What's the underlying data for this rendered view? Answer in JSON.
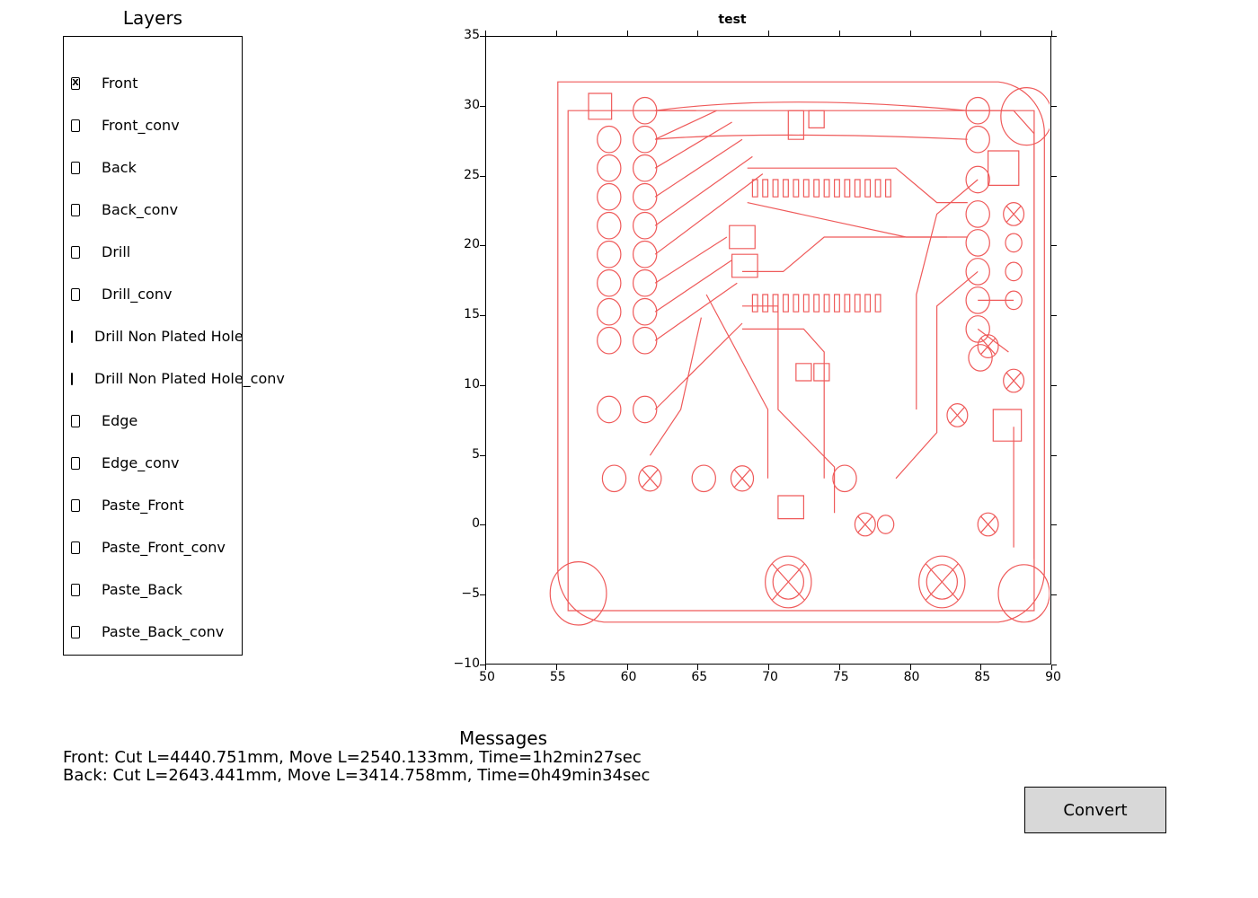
{
  "layers_panel": {
    "title": "Layers",
    "items": [
      {
        "label": "Front",
        "checked": true
      },
      {
        "label": "Front_conv",
        "checked": false
      },
      {
        "label": "Back",
        "checked": false
      },
      {
        "label": "Back_conv",
        "checked": false
      },
      {
        "label": "Drill",
        "checked": false
      },
      {
        "label": "Drill_conv",
        "checked": false
      },
      {
        "label": "Drill Non Plated Hole",
        "checked": false
      },
      {
        "label": "Drill Non Plated Hole_conv",
        "checked": false
      },
      {
        "label": "Edge",
        "checked": false
      },
      {
        "label": "Edge_conv",
        "checked": false
      },
      {
        "label": "Paste_Front",
        "checked": false
      },
      {
        "label": "Paste_Front_conv",
        "checked": false
      },
      {
        "label": "Paste_Back",
        "checked": false
      },
      {
        "label": "Paste_Back_conv",
        "checked": false
      }
    ]
  },
  "messages_panel": {
    "title": "Messages",
    "lines": [
      "Front: Cut L=4440.751mm, Move L=2540.133mm, Time=1h2min27sec",
      "Back: Cut L=2643.441mm, Move L=3414.758mm, Time=0h49min34sec"
    ]
  },
  "buttons": {
    "convert": "Convert"
  },
  "colors": {
    "pcb_stroke": "#ef5a5a",
    "axis": "#000000",
    "button_bg": "#d8d8d8"
  },
  "chart_data": {
    "type": "line",
    "title": "test",
    "xlabel": "",
    "ylabel": "",
    "xlim": [
      50,
      90
    ],
    "ylim": [
      -10,
      35
    ],
    "xticks": [
      50,
      55,
      60,
      65,
      70,
      75,
      80,
      85,
      90
    ],
    "yticks": [
      -10,
      -5,
      0,
      5,
      10,
      15,
      20,
      25,
      30,
      35
    ],
    "description": "Red outline toolpaths of a PCB (layer 'Front'), drawn as many closed contours inside a rounded-corner square board. Shapes include pad rings, traces, and large circular mounting-hole clearances in the four corner regions.",
    "board_outline_approx": {
      "x": [
        53.3,
        88.8
      ],
      "y": [
        -8.4,
        30.7
      ]
    },
    "mounting_holes_approx": [
      {
        "cx": 88.3,
        "cy": 29.7,
        "r": 1.8
      },
      {
        "cx": 56.2,
        "cy": -6.1,
        "r": 2.0
      },
      {
        "cx": 71.3,
        "cy": -5.6,
        "r": 1.7
      },
      {
        "cx": 82.7,
        "cy": -5.6,
        "r": 1.7
      },
      {
        "cx": 88.3,
        "cy": -6.1,
        "r": 1.8
      }
    ],
    "left_pad_columns_approx": {
      "x_columns": [
        57.4,
        60.0
      ],
      "y_values": [
        28.3,
        26.1,
        24.0,
        21.9,
        19.8,
        17.7,
        15.5,
        13.3,
        11.0,
        5.3,
        -0.2
      ],
      "pad_r": 0.8
    },
    "right_pad_column_approx": {
      "x": 84.6,
      "y_values": [
        28.3,
        26.4,
        23.6,
        21.2,
        19.1,
        17.0,
        14.9,
        12.8,
        10.7
      ],
      "pad_r": 0.8
    },
    "smd_rows_approx": [
      {
        "y": 20.8,
        "x_range": [
          68.8,
          77.3
        ],
        "count": 14
      },
      {
        "y": 12.4,
        "x_range": [
          68.3,
          76.8
        ],
        "count": 14
      }
    ]
  }
}
